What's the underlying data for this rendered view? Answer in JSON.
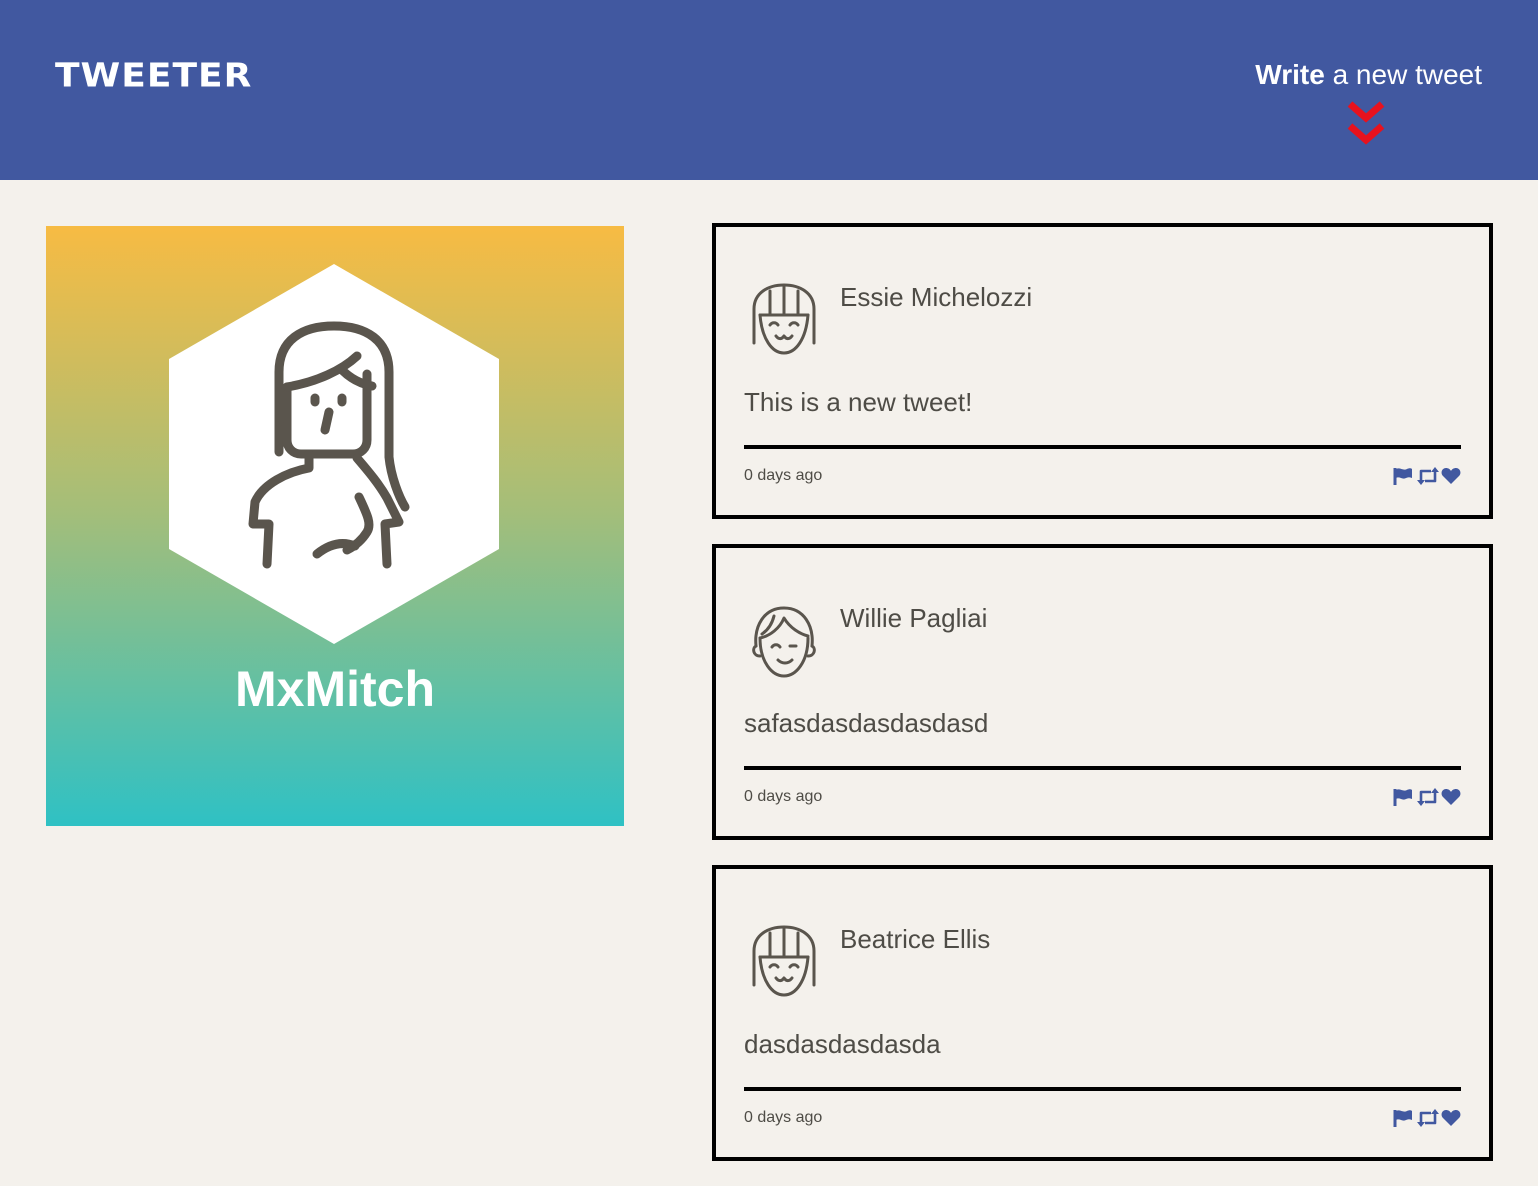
{
  "nav": {
    "brand": "TWEETER",
    "compose_bold": "Write",
    "compose_rest": " a new tweet",
    "compose_arrow_color": "#e8121e"
  },
  "profile": {
    "name": "MxMitch",
    "avatar_icon": "woman-long-hair-avatar-icon"
  },
  "tweets": [
    {
      "author": "Essie Michelozzi",
      "avatar_icon": "girl-bangs-smiling-avatar-icon",
      "content": "This is a new tweet!",
      "time": "0 days ago"
    },
    {
      "author": "Willie Pagliai",
      "avatar_icon": "boy-winking-avatar-icon",
      "content": "safasdasdasdasdasd",
      "time": "0 days ago"
    },
    {
      "author": "Beatrice Ellis",
      "avatar_icon": "girl-bangs-smiling-avatar-icon",
      "content": "dasdasdasdasda",
      "time": "0 days ago"
    }
  ],
  "actions": [
    "flag-icon",
    "retweet-icon",
    "heart-icon"
  ],
  "colors": {
    "nav_bg": "#4158a0",
    "page_bg": "#f4f1ec",
    "action_icon": "#4158a0",
    "gradient_top": "#f7bb43",
    "gradient_bottom": "#2fc1c4"
  }
}
